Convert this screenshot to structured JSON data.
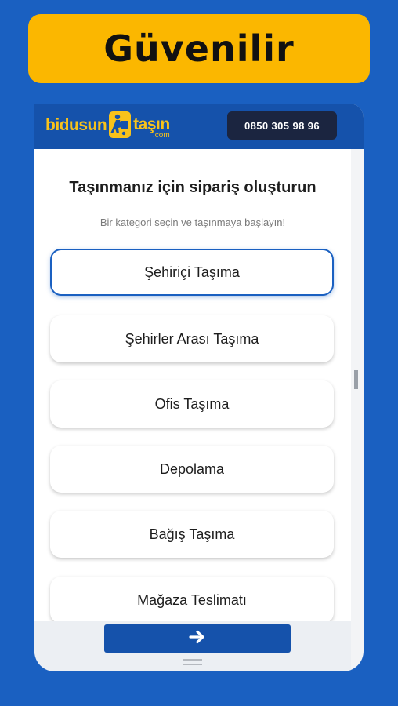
{
  "banner": {
    "text": "Güvenilir"
  },
  "header": {
    "logo_left": "bidusun",
    "logo_right": "taşın",
    "logo_suffix": ".com",
    "phone": "0850 305 98 96"
  },
  "main": {
    "title": "Taşınmanız için sipariş oluşturun",
    "subtitle": "Bir kategori seçin ve taşınmaya başlayın!",
    "categories": [
      {
        "label": "Şehiriçi Taşıma",
        "selected": true
      },
      {
        "label": "Şehirler Arası Taşıma",
        "selected": false
      },
      {
        "label": "Ofis Taşıma",
        "selected": false
      },
      {
        "label": "Depolama",
        "selected": false
      },
      {
        "label": "Bağış Taşıma",
        "selected": false
      },
      {
        "label": "Mağaza Teslimatı",
        "selected": false
      }
    ]
  },
  "footer": {
    "next_icon": "arrow-right-icon"
  },
  "colors": {
    "background": "#1a60c1",
    "banner": "#fbb700",
    "header": "#1552ab",
    "logo": "#f8c21b",
    "phone_badge": "#1b2540",
    "selected_border": "#1a60c1"
  }
}
